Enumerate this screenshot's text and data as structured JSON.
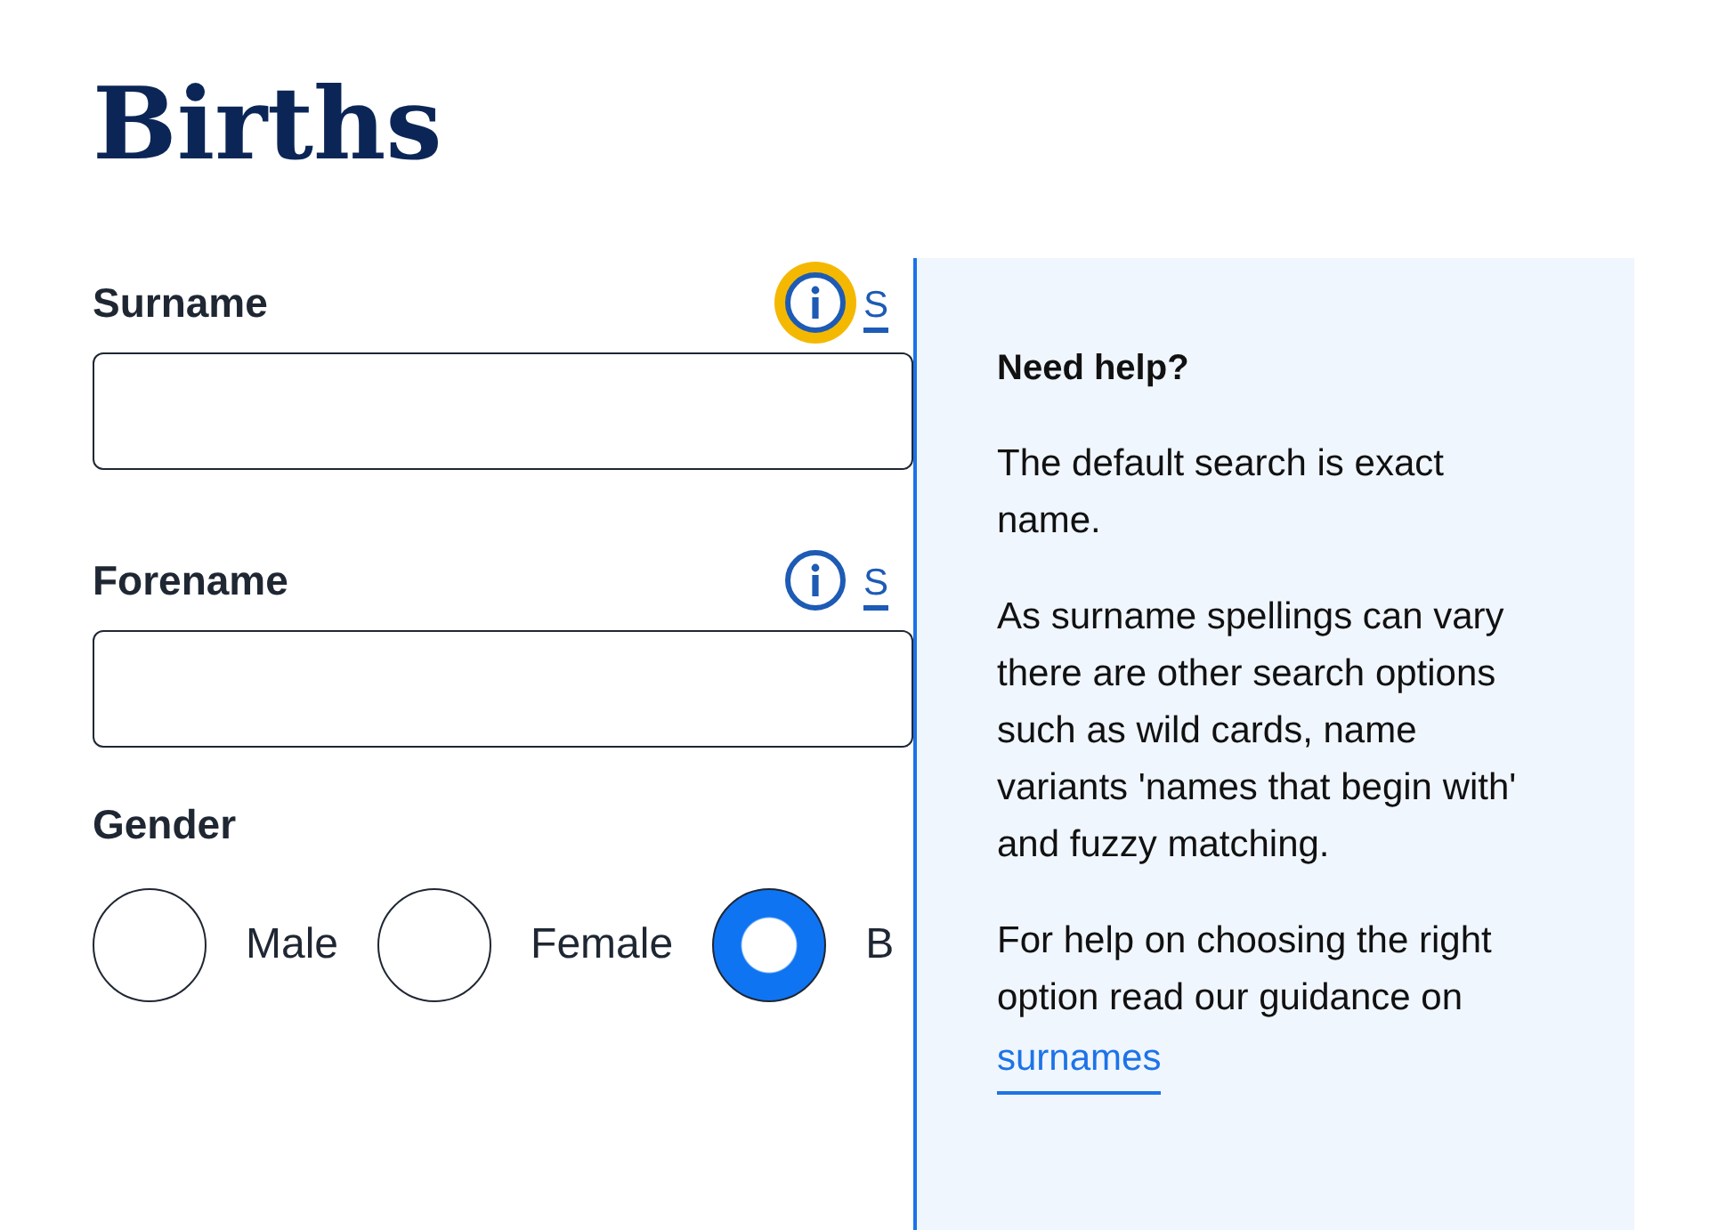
{
  "title": "Births",
  "fields": [
    {
      "label": "Surname",
      "info_focused": true,
      "link_text": "S"
    },
    {
      "label": "Forename",
      "info_focused": false,
      "link_text": "S"
    }
  ],
  "gender": {
    "label": "Gender",
    "options": [
      {
        "label": "Male",
        "selected": false
      },
      {
        "label": "Female",
        "selected": false
      },
      {
        "label": "B",
        "selected": true
      }
    ]
  },
  "help_panel": {
    "heading": "Need help?",
    "paragraphs": [
      "The default search is exact name.",
      "As surname spellings can vary there are other search options such as wild cards, name variants 'names that begin with' and fuzzy matching.",
      "For help on choosing the right option read our guidance on"
    ],
    "link": "surnames"
  }
}
